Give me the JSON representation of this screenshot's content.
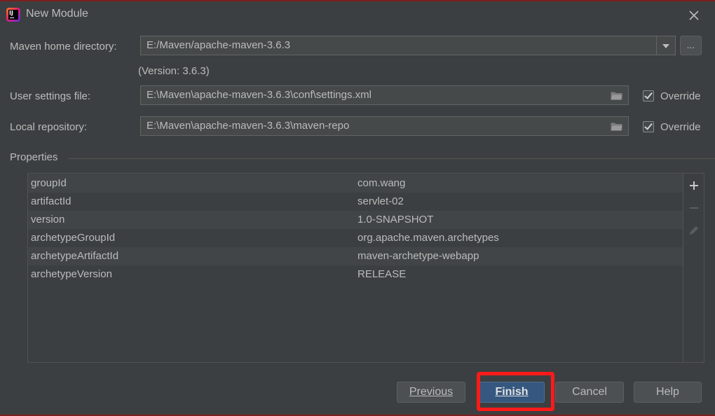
{
  "window": {
    "title": "New Module"
  },
  "maven_home": {
    "label": "Maven home directory:",
    "value": "E:/Maven/apache-maven-3.6.3",
    "version": "(Version: 3.6.3)"
  },
  "user_settings": {
    "label": "User settings file:",
    "value": "E:\\Maven\\apache-maven-3.6.3\\conf\\settings.xml",
    "override_label": "Override",
    "override_checked": true
  },
  "local_repo": {
    "label": "Local repository:",
    "value": "E:\\Maven\\apache-maven-3.6.3\\maven-repo",
    "override_label": "Override",
    "override_checked": true
  },
  "properties": {
    "label": "Properties",
    "rows": [
      {
        "key": "groupId",
        "value": "com.wang"
      },
      {
        "key": "artifactId",
        "value": "servlet-02"
      },
      {
        "key": "version",
        "value": "1.0-SNAPSHOT"
      },
      {
        "key": "archetypeGroupId",
        "value": "org.apache.maven.archetypes"
      },
      {
        "key": "archetypeArtifactId",
        "value": "maven-archetype-webapp"
      },
      {
        "key": "archetypeVersion",
        "value": "RELEASE"
      }
    ]
  },
  "buttons": {
    "browse": "...",
    "previous": "Previous",
    "finish": "Finish",
    "cancel": "Cancel",
    "help": "Help"
  },
  "colors": {
    "background": "#3c3f41",
    "default_button": "#365880",
    "highlight": "#ff1a1a"
  }
}
